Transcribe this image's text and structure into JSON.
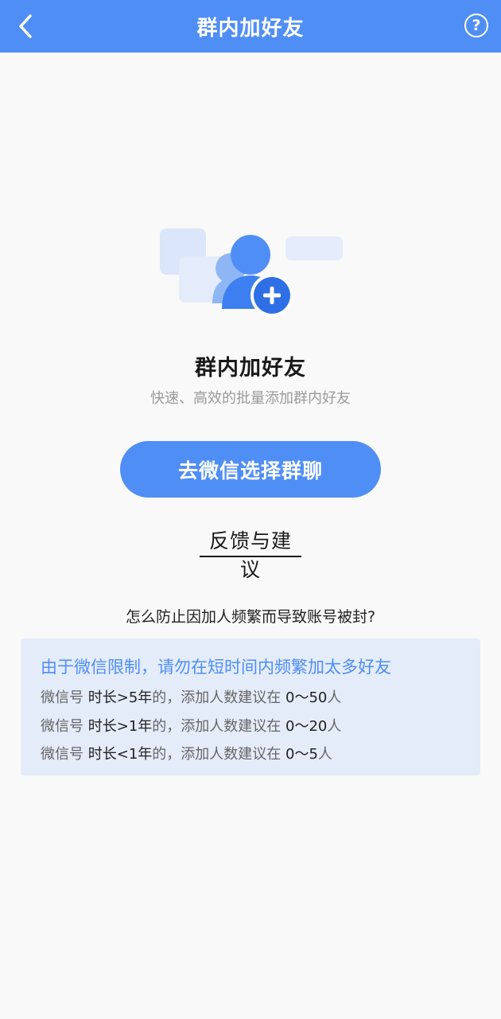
{
  "header": {
    "title": "群内加好友",
    "help_label": "?"
  },
  "hero": {
    "icon": "user-add-icon",
    "title": "群内加好友",
    "subtitle": "快速、高效的批量添加群内好友"
  },
  "actions": {
    "primary_label": "去微信选择群聊",
    "feedback_label": "反馈与建议"
  },
  "faq": {
    "question": "怎么防止因加人频繁而导致账号被封?"
  },
  "limits": {
    "headline": "由于微信限制，请勿在短时间内频繁加太多好友",
    "rows": [
      {
        "prefix": "微信号",
        "duration": "时长>5年",
        "mid": "的，添加人数建议在",
        "range": "0～50",
        "suffix": "人"
      },
      {
        "prefix": "微信号",
        "duration": "时长>1年",
        "mid": "的，添加人数建议在",
        "range": "0～20",
        "suffix": "人"
      },
      {
        "prefix": "微信号",
        "duration": "时长<1年",
        "mid": "的，添加人数建议在",
        "range": "0～5",
        "suffix": "人"
      }
    ]
  },
  "colors": {
    "accent": "#4f8ef5",
    "info_bg": "#e4ecfa",
    "page_bg": "#f9f9f9"
  }
}
